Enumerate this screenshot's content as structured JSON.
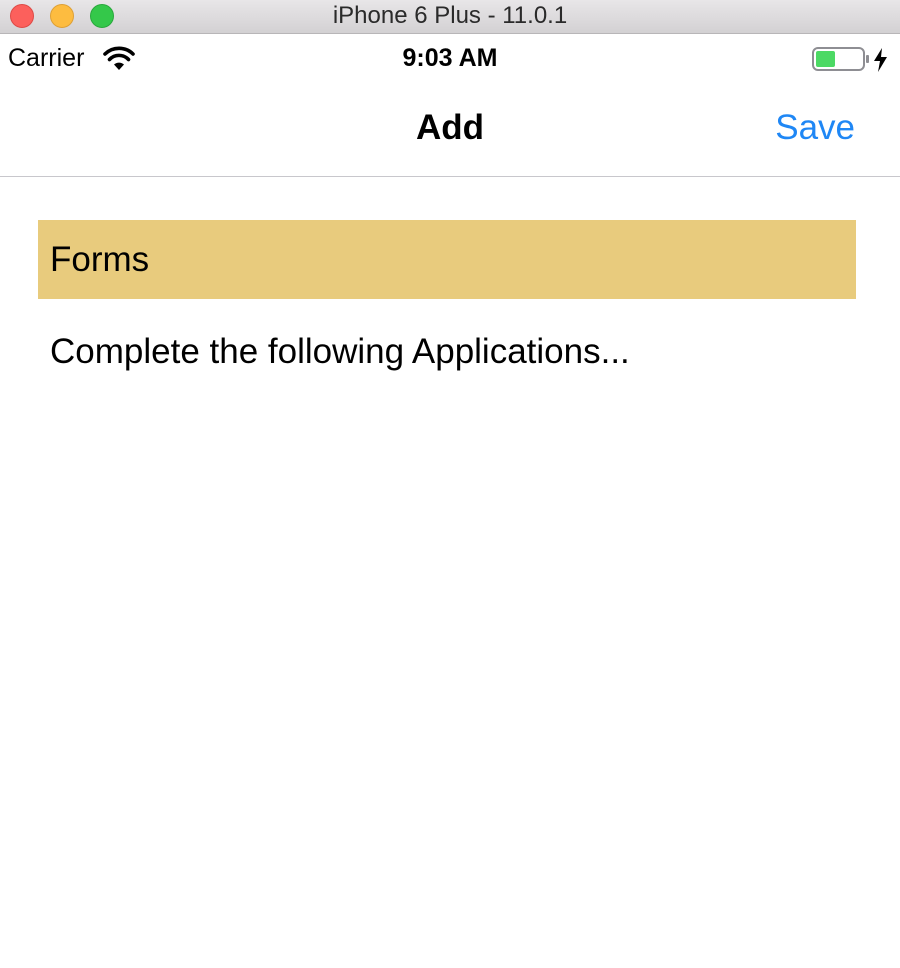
{
  "window": {
    "title": "iPhone 6 Plus - 11.0.1"
  },
  "status_bar": {
    "carrier": "Carrier",
    "time": "9:03 AM",
    "battery_color": "#4cd964"
  },
  "nav": {
    "title": "Add",
    "save_label": "Save",
    "accent_color": "#1f87f5"
  },
  "content": {
    "section_header": "Forms",
    "section_header_color": "#e8cb7d",
    "instruction": "Complete the following Applications..."
  },
  "icons": {
    "wifi": "wifi-icon",
    "battery": "battery-charging-icon"
  }
}
